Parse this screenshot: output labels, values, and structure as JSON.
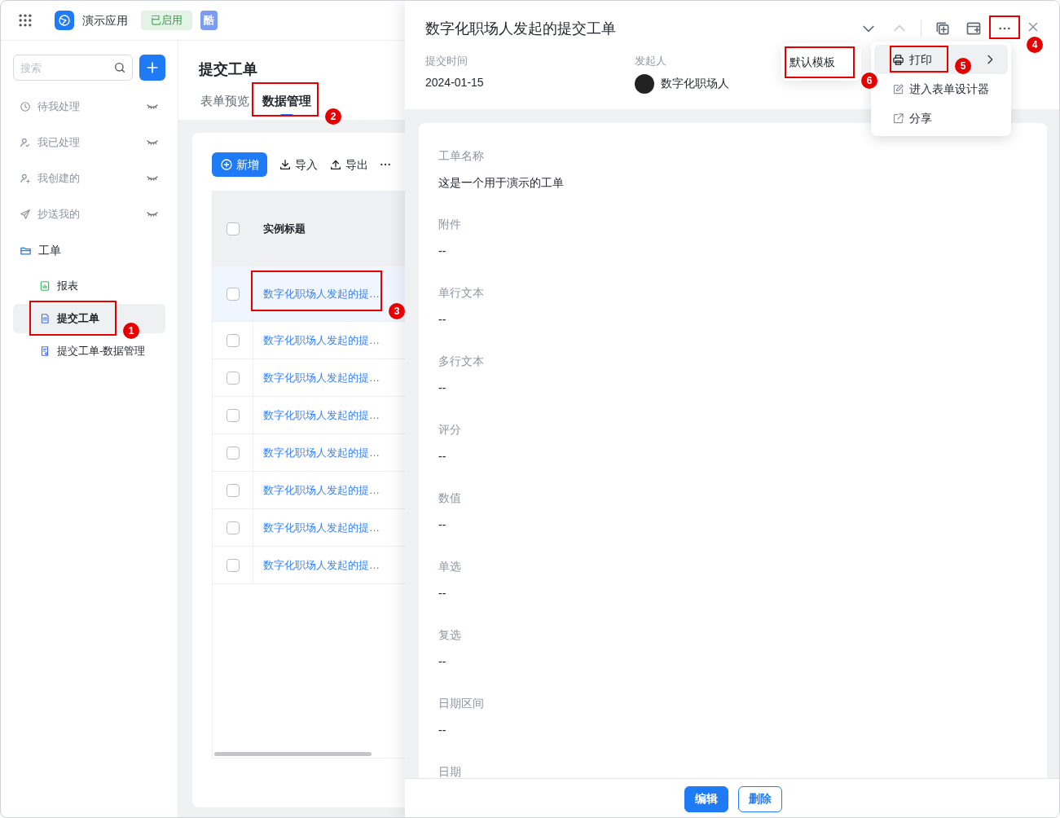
{
  "app": {
    "name": "演示应用",
    "status": "已启用",
    "badge": "酷"
  },
  "sidebar": {
    "search": {
      "placeholder": "搜索"
    },
    "items": [
      {
        "label": "待我处理",
        "kind": "inbox"
      },
      {
        "label": "我已处理",
        "kind": "inbox"
      },
      {
        "label": "我创建的",
        "kind": "inbox"
      },
      {
        "label": "抄送我的",
        "kind": "inbox"
      },
      {
        "label": "工单",
        "kind": "group",
        "children": [
          {
            "label": "报表",
            "kind": "report",
            "selected": false
          },
          {
            "label": "提交工单",
            "kind": "form",
            "selected": true,
            "callout": "1"
          },
          {
            "label": "提交工单-数据管理",
            "kind": "data",
            "selected": false
          }
        ]
      }
    ]
  },
  "page": {
    "title": "提交工单",
    "tabs": [
      {
        "label": "表单预览",
        "selected": false
      },
      {
        "label": "数据管理",
        "selected": true,
        "callout": "2"
      }
    ],
    "toolbar": [
      {
        "label": "新增",
        "kind": "primary"
      },
      {
        "label": "导入",
        "kind": "import"
      },
      {
        "label": "导出",
        "kind": "export"
      }
    ],
    "table": {
      "columns": [
        "实例标题"
      ],
      "select_all": {
        "checked": false
      },
      "rows": [
        {
          "title": "数字化职场人发起的提…",
          "checked": false,
          "selected": true,
          "callout": "3"
        },
        {
          "title": "数字化职场人发起的提…",
          "checked": false,
          "selected": false
        },
        {
          "title": "数字化职场人发起的提…",
          "checked": false,
          "selected": false
        },
        {
          "title": "数字化职场人发起的提…",
          "checked": false,
          "selected": false
        },
        {
          "title": "数字化职场人发起的提…",
          "checked": false,
          "selected": false
        },
        {
          "title": "数字化职场人发起的提…",
          "checked": false,
          "selected": false
        },
        {
          "title": "数字化职场人发起的提…",
          "checked": false,
          "selected": false
        },
        {
          "title": "数字化职场人发起的提…",
          "checked": false,
          "selected": false
        }
      ]
    }
  },
  "drawer": {
    "title": "数字化职场人发起的提交工单",
    "more_callout": "4",
    "meta": [
      {
        "label": "提交时间",
        "value": "2024-01-15",
        "kind": "text"
      },
      {
        "label": "发起人",
        "value": "数字化职场人",
        "kind": "user"
      }
    ],
    "menu": [
      {
        "label": "打印",
        "kind": "submenu",
        "selected": true,
        "callout": "5"
      },
      {
        "label": "进入表单设计器",
        "kind": "action",
        "selected": false
      },
      {
        "label": "分享",
        "kind": "action",
        "selected": false
      }
    ],
    "submenu": [
      {
        "label": "默认模板",
        "callout": "6"
      }
    ],
    "fields": [
      {
        "label": "工单名称",
        "value": "这是一个用于演示的工单"
      },
      {
        "label": "附件",
        "value": "--"
      },
      {
        "label": "单行文本",
        "value": "--"
      },
      {
        "label": "多行文本",
        "value": "--"
      },
      {
        "label": "评分",
        "value": "--"
      },
      {
        "label": "数值",
        "value": "--"
      },
      {
        "label": "单选",
        "value": "--"
      },
      {
        "label": "复选",
        "value": "--"
      },
      {
        "label": "日期区间",
        "value": "--"
      },
      {
        "label": "日期"
      }
    ],
    "buttons": [
      {
        "label": "编辑",
        "kind": "primary"
      },
      {
        "label": "删除",
        "kind": "outline"
      }
    ]
  }
}
